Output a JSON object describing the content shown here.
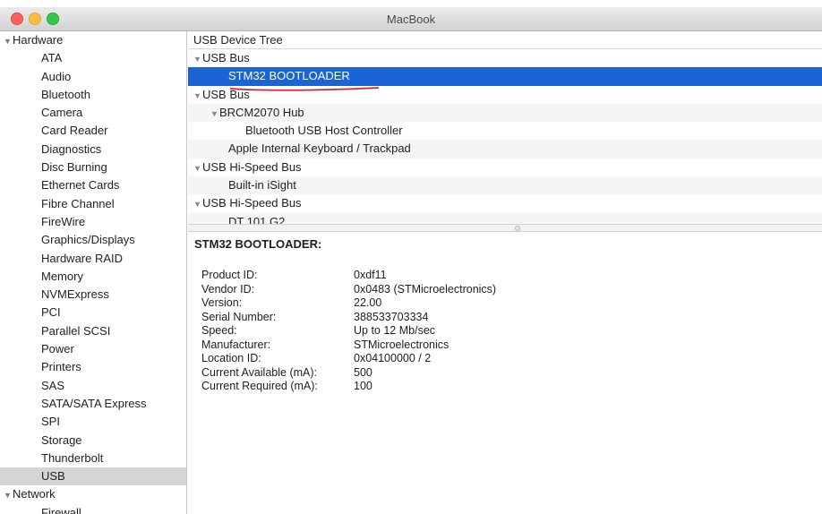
{
  "window": {
    "title": "MacBook"
  },
  "sidebar": {
    "groups": [
      {
        "label": "Hardware",
        "items": [
          {
            "label": "ATA"
          },
          {
            "label": "Audio"
          },
          {
            "label": "Bluetooth"
          },
          {
            "label": "Camera"
          },
          {
            "label": "Card Reader"
          },
          {
            "label": "Diagnostics"
          },
          {
            "label": "Disc Burning"
          },
          {
            "label": "Ethernet Cards"
          },
          {
            "label": "Fibre Channel"
          },
          {
            "label": "FireWire"
          },
          {
            "label": "Graphics/Displays"
          },
          {
            "label": "Hardware RAID"
          },
          {
            "label": "Memory"
          },
          {
            "label": "NVMExpress"
          },
          {
            "label": "PCI"
          },
          {
            "label": "Parallel SCSI"
          },
          {
            "label": "Power"
          },
          {
            "label": "Printers"
          },
          {
            "label": "SAS"
          },
          {
            "label": "SATA/SATA Express"
          },
          {
            "label": "SPI"
          },
          {
            "label": "Storage"
          },
          {
            "label": "Thunderbolt"
          },
          {
            "label": "USB"
          }
        ],
        "selected_item": "USB"
      },
      {
        "label": "Network",
        "items": [
          {
            "label": "Firewall"
          }
        ]
      }
    ]
  },
  "tree": {
    "header": "USB Device Tree",
    "rows": [
      {
        "label": "USB Bus",
        "level": 0,
        "expandable": true
      },
      {
        "label": "STM32  BOOTLOADER",
        "level": 1,
        "expandable": false,
        "selected": true
      },
      {
        "label": "USB Bus",
        "level": 0,
        "expandable": true
      },
      {
        "label": "BRCM2070 Hub",
        "level": 1,
        "expandable": true
      },
      {
        "label": "Bluetooth USB Host Controller",
        "level": 2,
        "expandable": false
      },
      {
        "label": "Apple Internal Keyboard / Trackpad",
        "level": 1,
        "expandable": false
      },
      {
        "label": "USB Hi-Speed Bus",
        "level": 0,
        "expandable": true
      },
      {
        "label": "Built-in iSight",
        "level": 1,
        "expandable": false
      },
      {
        "label": "USB Hi-Speed Bus",
        "level": 0,
        "expandable": true
      },
      {
        "label": "DT 101 G2",
        "level": 1,
        "expandable": false
      }
    ]
  },
  "detail": {
    "title": "STM32  BOOTLOADER:",
    "properties": [
      {
        "label": "Product ID:",
        "value": "0xdf11"
      },
      {
        "label": "Vendor ID:",
        "value": "0x0483  (STMicroelectronics)"
      },
      {
        "label": "Version:",
        "value": "22.00"
      },
      {
        "label": "Serial Number:",
        "value": "388533703334"
      },
      {
        "label": "Speed:",
        "value": "Up to 12 Mb/sec"
      },
      {
        "label": "Manufacturer:",
        "value": "STMicroelectronics"
      },
      {
        "label": "Location ID:",
        "value": "0x04100000 / 2"
      },
      {
        "label": "Current Available (mA):",
        "value": "500"
      },
      {
        "label": "Current Required (mA):",
        "value": "100"
      }
    ]
  },
  "colors": {
    "selection": "#1b64d6",
    "sidebar_selection": "#d5d5d5",
    "annotation_underline": "#d9232d"
  },
  "icons": {
    "disclosure": "disclosure-triangle-icon"
  }
}
